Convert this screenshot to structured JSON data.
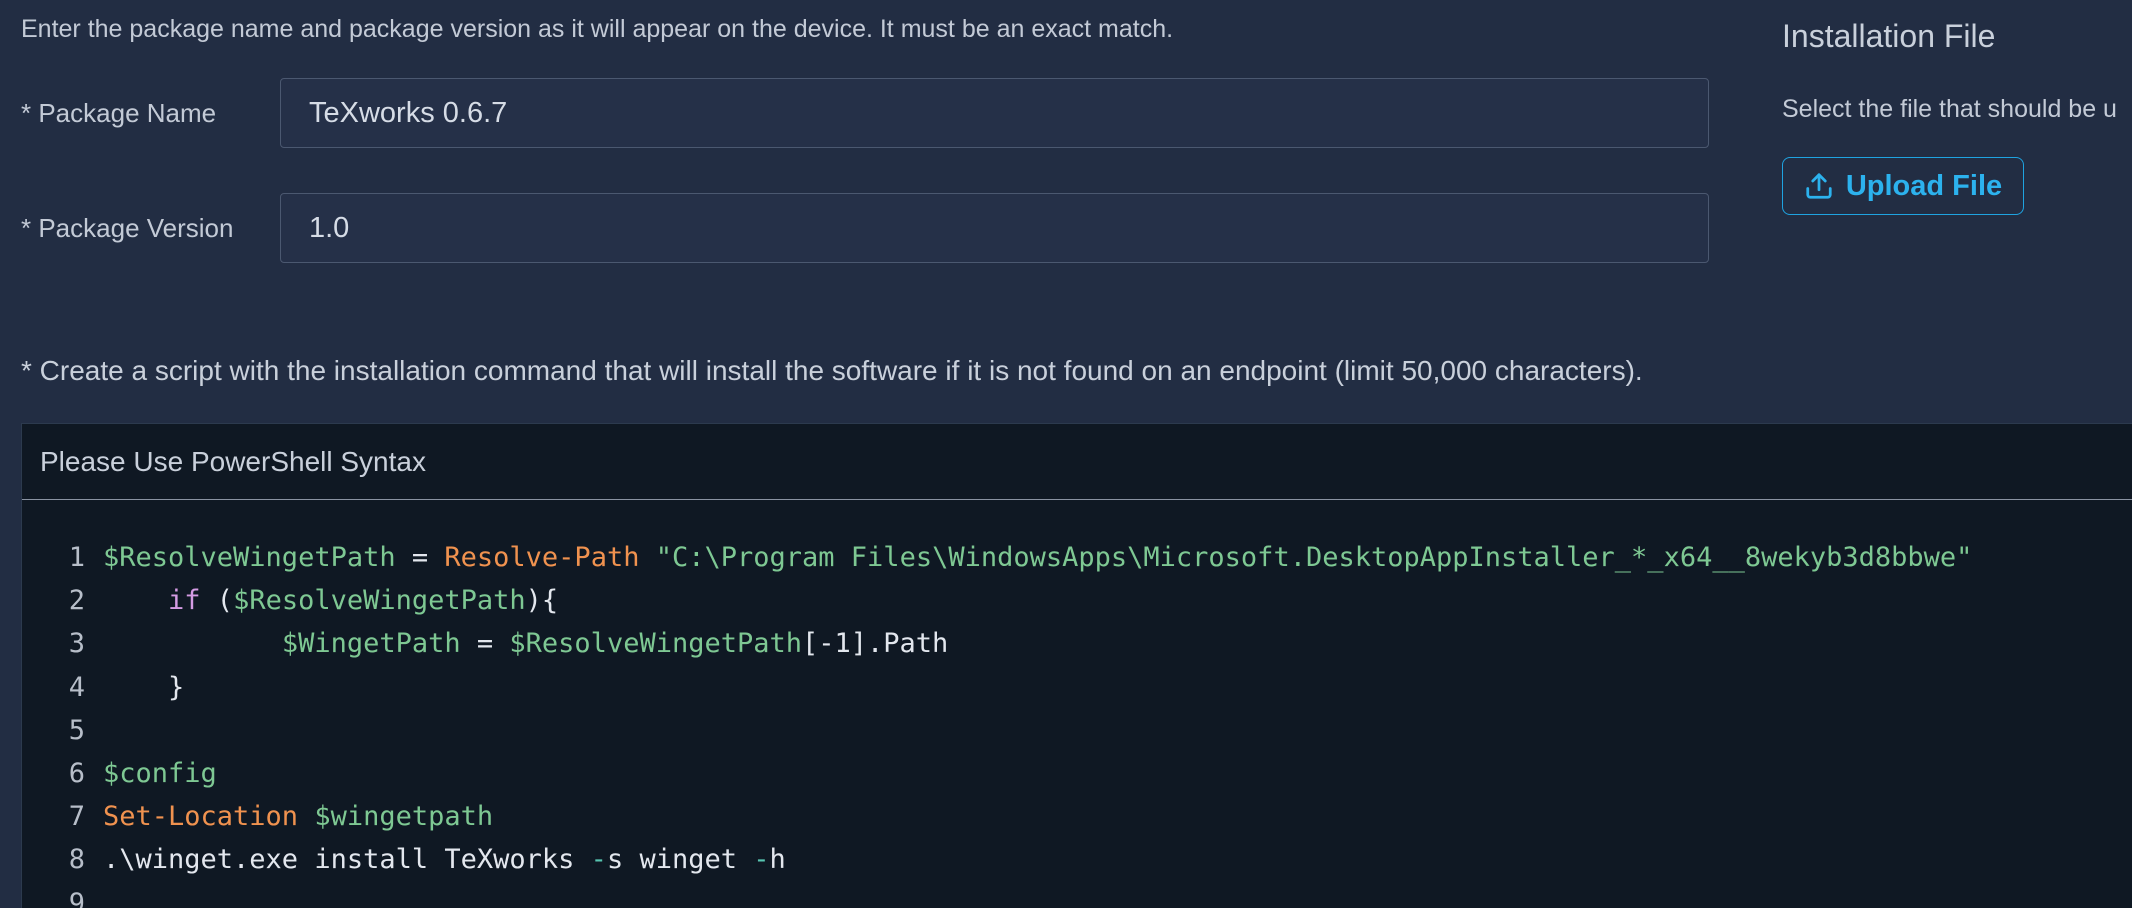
{
  "intro_text": "Enter the package name and package version as it will appear on the device. It must be an exact match.",
  "package_name": {
    "label": "* Package Name",
    "value": "TeXworks 0.6.7"
  },
  "package_version": {
    "label": "* Package Version",
    "value": "1.0"
  },
  "installation_file": {
    "title": "Installation File",
    "hint": "Select the file that should be u",
    "upload_label": "Upload File",
    "upload_icon": "upload-icon",
    "accent_color": "#2cb2ee"
  },
  "script_instruction": "* Create a script with the installation command that will install the software if it is not found on an endpoint (limit 50,000 characters).",
  "editor": {
    "header": "Please Use PowerShell Syntax",
    "line_numbers": [
      "1",
      "2",
      "3",
      "4",
      "5",
      "6",
      "7",
      "8",
      "9"
    ],
    "lines": [
      [
        {
          "t": "$ResolveWingetPath",
          "k": "var"
        },
        {
          "t": " = ",
          "k": "plain"
        },
        {
          "t": "Resolve-Path",
          "k": "cmd"
        },
        {
          "t": " ",
          "k": "plain"
        },
        {
          "t": "\"C:\\Program Files\\WindowsApps\\Microsoft.DesktopAppInstaller_*_x64__8wekyb3d8bbwe\"",
          "k": "str"
        }
      ],
      [
        {
          "t": "    ",
          "k": "plain"
        },
        {
          "t": "if",
          "k": "kw"
        },
        {
          "t": " (",
          "k": "plain"
        },
        {
          "t": "$ResolveWingetPath",
          "k": "var"
        },
        {
          "t": "){",
          "k": "plain"
        }
      ],
      [
        {
          "t": "           ",
          "k": "plain"
        },
        {
          "t": "$WingetPath",
          "k": "var"
        },
        {
          "t": " = ",
          "k": "plain"
        },
        {
          "t": "$ResolveWingetPath",
          "k": "var"
        },
        {
          "t": "[-1].Path",
          "k": "plain"
        }
      ],
      [
        {
          "t": "    }",
          "k": "plain"
        }
      ],
      [],
      [
        {
          "t": "$config",
          "k": "var"
        }
      ],
      [
        {
          "t": "Set-Location",
          "k": "cmd"
        },
        {
          "t": " ",
          "k": "plain"
        },
        {
          "t": "$wingetpath",
          "k": "var"
        }
      ],
      [
        {
          "t": ".\\winget.exe install TeXworks ",
          "k": "plain"
        },
        {
          "t": "-",
          "k": "op"
        },
        {
          "t": "s winget ",
          "k": "plain"
        },
        {
          "t": "-",
          "k": "op"
        },
        {
          "t": "h",
          "k": "plain"
        }
      ],
      []
    ]
  }
}
